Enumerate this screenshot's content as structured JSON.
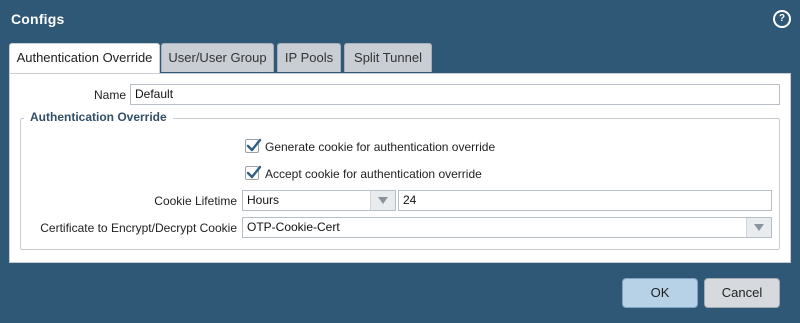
{
  "dialog": {
    "title": "Configs",
    "help_icon": "?"
  },
  "tabs": [
    {
      "label": "Authentication Override",
      "active": true
    },
    {
      "label": "User/User Group",
      "active": false
    },
    {
      "label": "IP Pools",
      "active": false
    },
    {
      "label": "Split Tunnel",
      "active": false
    }
  ],
  "form": {
    "name_label": "Name",
    "name_value": "Default",
    "section_title": "Authentication Override",
    "generate_cookie": {
      "label": "Generate cookie for authentication override",
      "checked": true
    },
    "accept_cookie": {
      "label": "Accept cookie for authentication override",
      "checked": true
    },
    "cookie_lifetime": {
      "label": "Cookie Lifetime",
      "unit": "Hours",
      "value": "24"
    },
    "certificate": {
      "label": "Certificate to Encrypt/Decrypt Cookie",
      "value": "OTP-Cookie-Cert"
    }
  },
  "buttons": {
    "ok": "OK",
    "cancel": "Cancel"
  },
  "colors": {
    "frame": "#2f5877",
    "ok_button": "#b7d2e6",
    "cancel_button": "#d6dade",
    "checkbox_check": "#2f5e86"
  }
}
